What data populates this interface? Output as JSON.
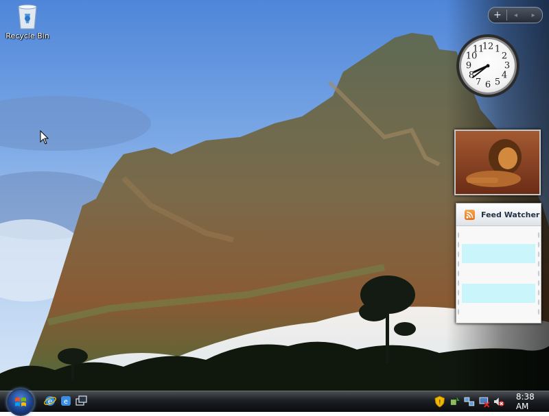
{
  "desktop": {
    "icons": [
      {
        "label": "Recycle Bin",
        "icon": "recycle-bin-icon"
      }
    ]
  },
  "sidebar": {
    "controls": {
      "add": "+",
      "prev": "◂",
      "next": "▸"
    },
    "clock": {
      "numbers": [
        "12",
        "1",
        "2",
        "3",
        "4",
        "5",
        "6",
        "7",
        "8",
        "9",
        "10",
        "11"
      ],
      "time": "8:38"
    },
    "slideshow": {
      "image": "lion-photo"
    },
    "feed_watcher": {
      "title": "Feed Watcher",
      "icon": "rss-feed-icon",
      "item_color": "#c9f5fb"
    }
  },
  "taskbar": {
    "start": "windows-start-icon",
    "quick_launch": [
      "internet-explorer-icon",
      "internet-explorer-icon",
      "switch-windows-icon"
    ],
    "tray_icons": [
      "security-shield-icon",
      "safely-remove-hardware-icon",
      "network-icon",
      "network-disconnected-icon",
      "volume-muted-icon"
    ],
    "clock": "8:38 AM"
  }
}
